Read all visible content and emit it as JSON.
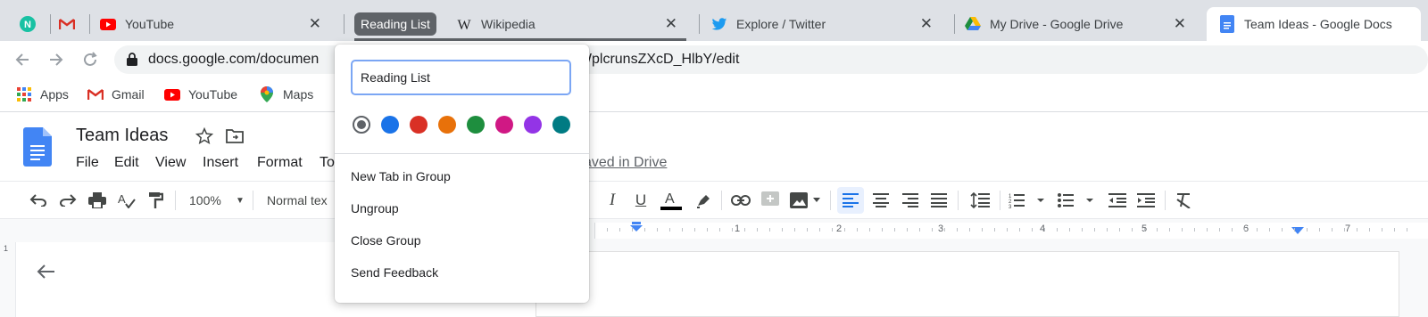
{
  "browser": {
    "tabs": [
      {
        "title": "",
        "icon": "n-icon"
      },
      {
        "title": "",
        "icon": "gmail-icon"
      },
      {
        "title": "YouTube",
        "icon": "youtube-icon",
        "close": "✕"
      },
      {
        "title": "Wikipedia",
        "icon": "wikipedia-icon",
        "close": "✕"
      },
      {
        "title": "Explore / Twitter",
        "icon": "twitter-icon",
        "close": "✕"
      },
      {
        "title": "My Drive - Google Drive",
        "icon": "google-drive-icon",
        "close": "✕"
      },
      {
        "title": "Team Ideas - Google Docs",
        "icon": "google-docs-icon"
      }
    ],
    "tab_group_label": "Reading List",
    "address": {
      "left": "docs.google.com/documen",
      "right": "tOWplcrunsZXcD_HlbY/edit"
    },
    "bookmarks": [
      {
        "label": "Apps",
        "icon": "apps-grid-icon"
      },
      {
        "label": "Gmail",
        "icon": "gmail-icon"
      },
      {
        "label": "YouTube",
        "icon": "youtube-icon"
      },
      {
        "label": "Maps",
        "icon": "maps-pin-icon"
      }
    ]
  },
  "doc": {
    "title": "Team Ideas",
    "menu": [
      "File",
      "Edit",
      "View",
      "Insert",
      "Format",
      "To"
    ],
    "saved_status": "aved in Drive"
  },
  "toolbar": {
    "zoom": "100%",
    "style": "Normal tex"
  },
  "ruler": {
    "numbers": [
      "1",
      "2",
      "3",
      "4",
      "5",
      "6",
      "7"
    ],
    "v_number": "1"
  },
  "tab_group_editor": {
    "name_value": "Reading List",
    "colors": [
      {
        "name": "grey",
        "hex": "#5f6368",
        "selected": true
      },
      {
        "name": "blue",
        "hex": "#1a73e8"
      },
      {
        "name": "red",
        "hex": "#d93025"
      },
      {
        "name": "orange",
        "hex": "#e8710a"
      },
      {
        "name": "green",
        "hex": "#1e8e3e"
      },
      {
        "name": "pink",
        "hex": "#d01884"
      },
      {
        "name": "purple",
        "hex": "#9334e6"
      },
      {
        "name": "cyan",
        "hex": "#007b83"
      }
    ],
    "items": [
      "New Tab in Group",
      "Ungroup",
      "Close Group",
      "Send Feedback"
    ]
  }
}
